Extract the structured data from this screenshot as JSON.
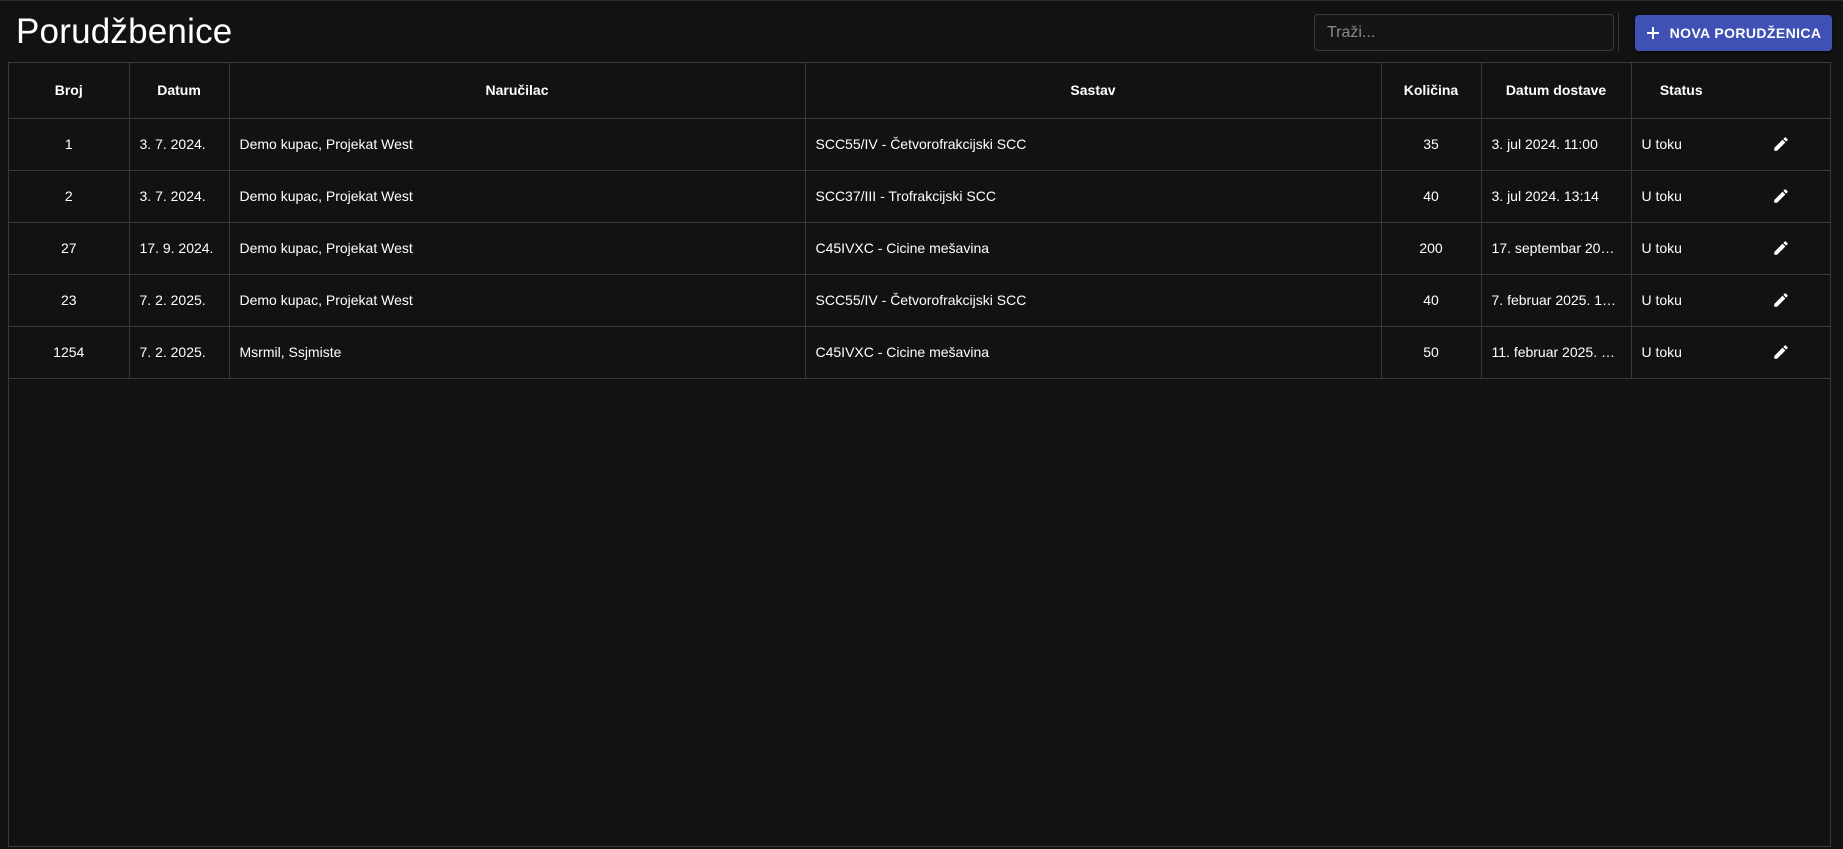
{
  "header": {
    "title": "Porudžbenice",
    "search_placeholder": "Traži...",
    "new_button_label": "NOVA PORUDŽENICA"
  },
  "colors": {
    "background": "#121212",
    "accent": "#3f51b5",
    "border": "#3a3a3a",
    "text": "#ffffff"
  },
  "table": {
    "columns": [
      "Broj",
      "Datum",
      "Naručilac",
      "Sastav",
      "Količina",
      "Datum dostave",
      "Status",
      ""
    ],
    "rows": [
      {
        "broj": "1",
        "datum": "3. 7. 2024.",
        "narucilac": "Demo kupac, Projekat West",
        "sastav": "SCC55/IV - Četvorofrakcijski SCC",
        "kolicina": "35",
        "datum_dostave": "3. jul 2024. 11:00",
        "status": "U toku",
        "action_icon": "edit-icon"
      },
      {
        "broj": "2",
        "datum": "3. 7. 2024.",
        "narucilac": "Demo kupac, Projekat West",
        "sastav": "SCC37/III - Trofrakcijski SCC",
        "kolicina": "40",
        "datum_dostave": "3. jul 2024. 13:14",
        "status": "U toku",
        "action_icon": "edit-icon"
      },
      {
        "broj": "27",
        "datum": "17. 9. 2024.",
        "narucilac": "Demo kupac, Projekat West",
        "sastav": "C45IVXC - Cicine mešavina",
        "kolicina": "200",
        "datum_dostave": "17. septembar 202…",
        "status": "U toku",
        "action_icon": "edit-icon"
      },
      {
        "broj": "23",
        "datum": "7. 2. 2025.",
        "narucilac": "Demo kupac, Projekat West",
        "sastav": "SCC55/IV - Četvorofrakcijski SCC",
        "kolicina": "40",
        "datum_dostave": "7. februar 2025. 1…",
        "status": "U toku",
        "action_icon": "edit-icon"
      },
      {
        "broj": "1254",
        "datum": "7. 2. 2025.",
        "narucilac": "Msrmil, Ssjmiste",
        "sastav": "C45IVXC - Cicine mešavina",
        "kolicina": "50",
        "datum_dostave": "11. februar 2025. …",
        "status": "U toku",
        "action_icon": "edit-icon"
      }
    ]
  }
}
